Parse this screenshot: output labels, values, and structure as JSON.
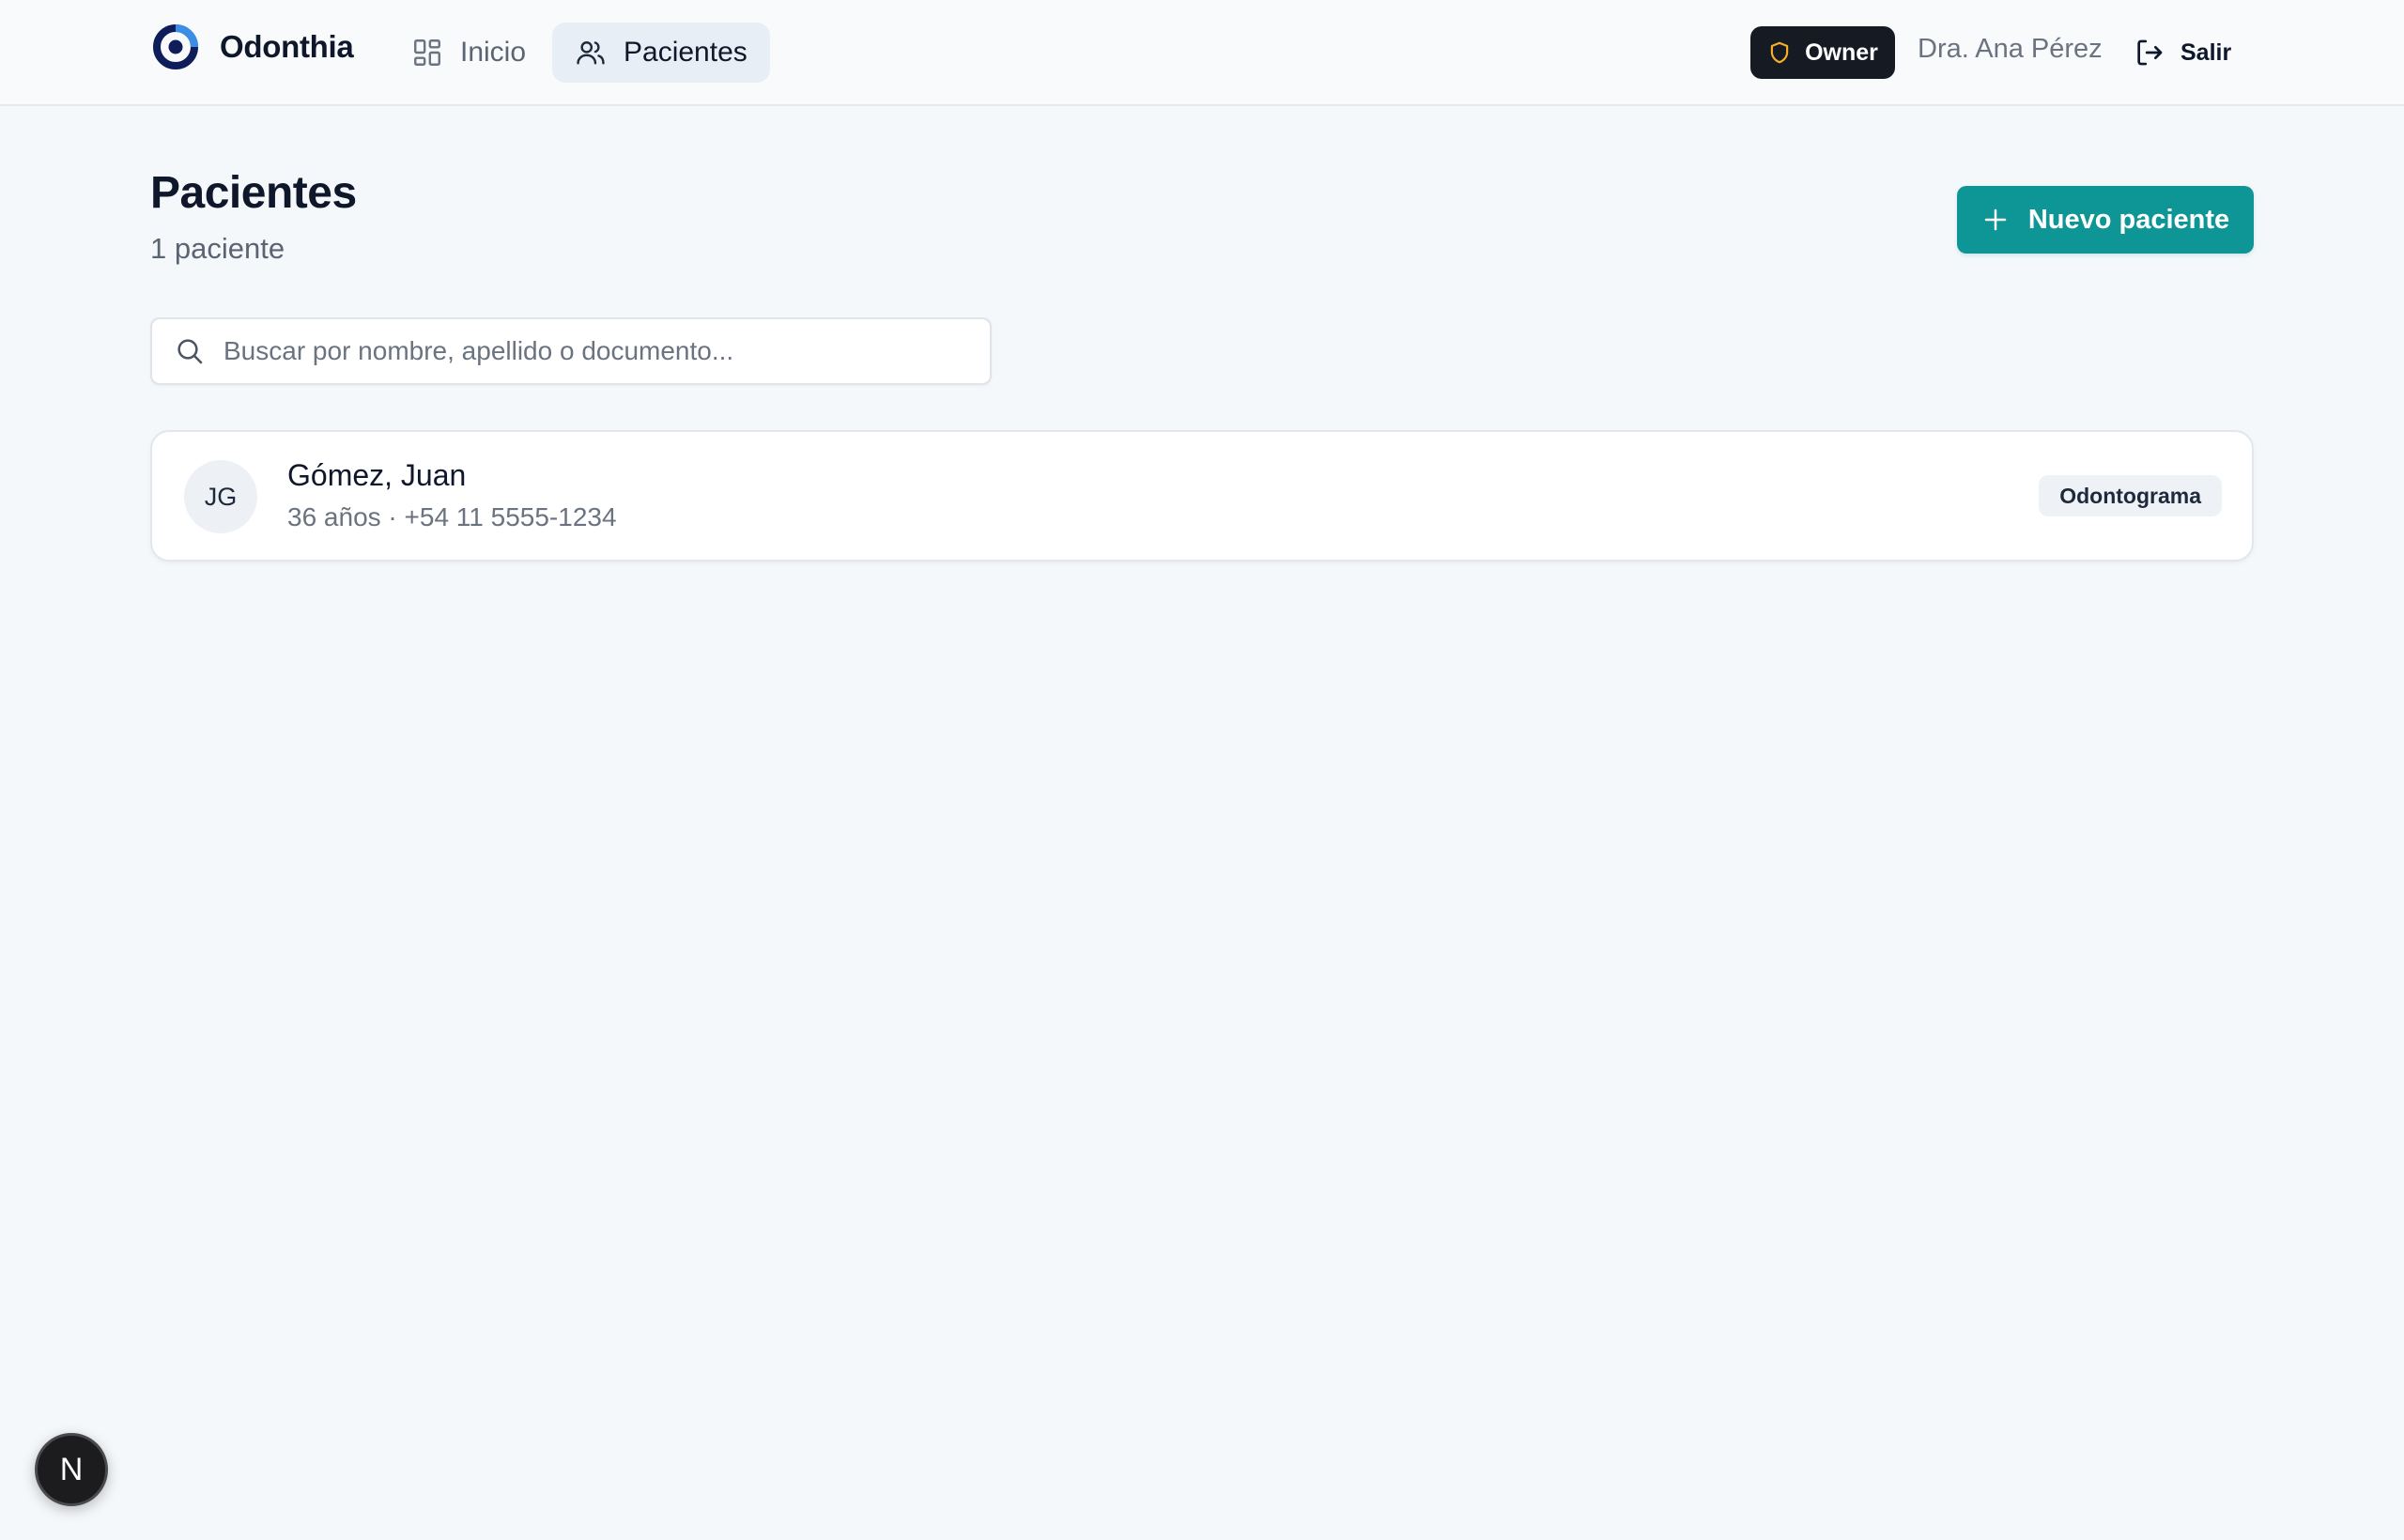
{
  "brand": {
    "name": "Odonthia",
    "icon": "logo-ring-icon",
    "colors": {
      "outer": "#0f1e5a",
      "inner": "#3a8ee6"
    }
  },
  "nav": {
    "items": [
      {
        "label": "Inicio",
        "icon": "dashboard-grid-icon",
        "active": false
      },
      {
        "label": "Pacientes",
        "icon": "users-icon",
        "active": true
      }
    ]
  },
  "header": {
    "role_badge": "Owner",
    "role_icon": "shield-icon",
    "role_icon_color": "#f5b025",
    "user_name": "Dra. Ana Pérez",
    "logout_label": "Salir",
    "logout_icon": "logout-icon"
  },
  "page": {
    "title": "Pacientes",
    "subtitle": "1 paciente",
    "new_button_label": "Nuevo paciente",
    "new_button_icon": "plus-icon",
    "accent_color": "#0e9696"
  },
  "search": {
    "placeholder": "Buscar por nombre, apellido o documento...",
    "value": "",
    "icon": "search-icon"
  },
  "patients": [
    {
      "initials": "JG",
      "name": "Gómez, Juan",
      "details": "36 años · +54 11 5555-1234",
      "tag": "Odontograma"
    }
  ],
  "dev_badge": {
    "label": "N"
  }
}
